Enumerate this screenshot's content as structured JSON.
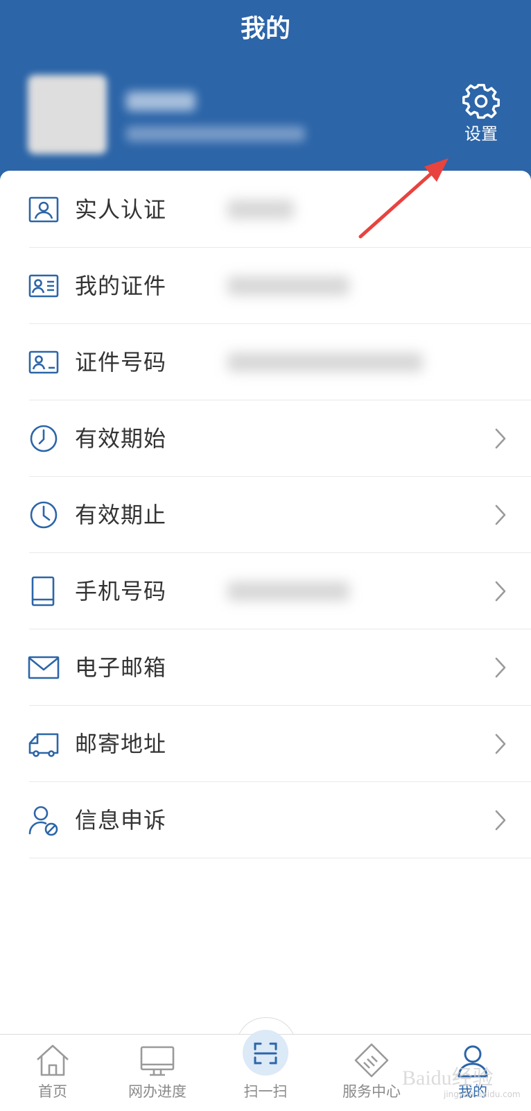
{
  "header": {
    "title": "我的",
    "settings_label": "设置"
  },
  "menu": [
    {
      "label": "实人认证",
      "icon": "id-card-person-icon",
      "chevron": false
    },
    {
      "label": "我的证件",
      "icon": "id-card-detail-icon",
      "chevron": false
    },
    {
      "label": "证件号码",
      "icon": "id-card-number-icon",
      "chevron": false
    },
    {
      "label": "有效期始",
      "icon": "clock-icon",
      "chevron": true
    },
    {
      "label": "有效期止",
      "icon": "clock-icon",
      "chevron": true
    },
    {
      "label": "手机号码",
      "icon": "tablet-icon",
      "chevron": true
    },
    {
      "label": "电子邮箱",
      "icon": "mail-icon",
      "chevron": true
    },
    {
      "label": "邮寄地址",
      "icon": "delivery-truck-icon",
      "chevron": true
    },
    {
      "label": "信息申诉",
      "icon": "user-block-icon",
      "chevron": true
    }
  ],
  "tabbar": {
    "tabs": [
      {
        "label": "首页",
        "icon": "home-icon"
      },
      {
        "label": "网办进度",
        "icon": "monitor-icon"
      },
      {
        "label": "扫一扫",
        "icon": "scan-icon"
      },
      {
        "label": "服务中心",
        "icon": "handshake-icon"
      },
      {
        "label": "我的",
        "icon": "user-icon"
      }
    ],
    "active_index": 4
  },
  "watermark": {
    "text": "Baidu经验",
    "sub": "jingyan.baidu.com"
  },
  "colors": {
    "brand": "#2c65a8",
    "icon": "#2c65a8",
    "annotation_arrow": "#e8433f"
  }
}
